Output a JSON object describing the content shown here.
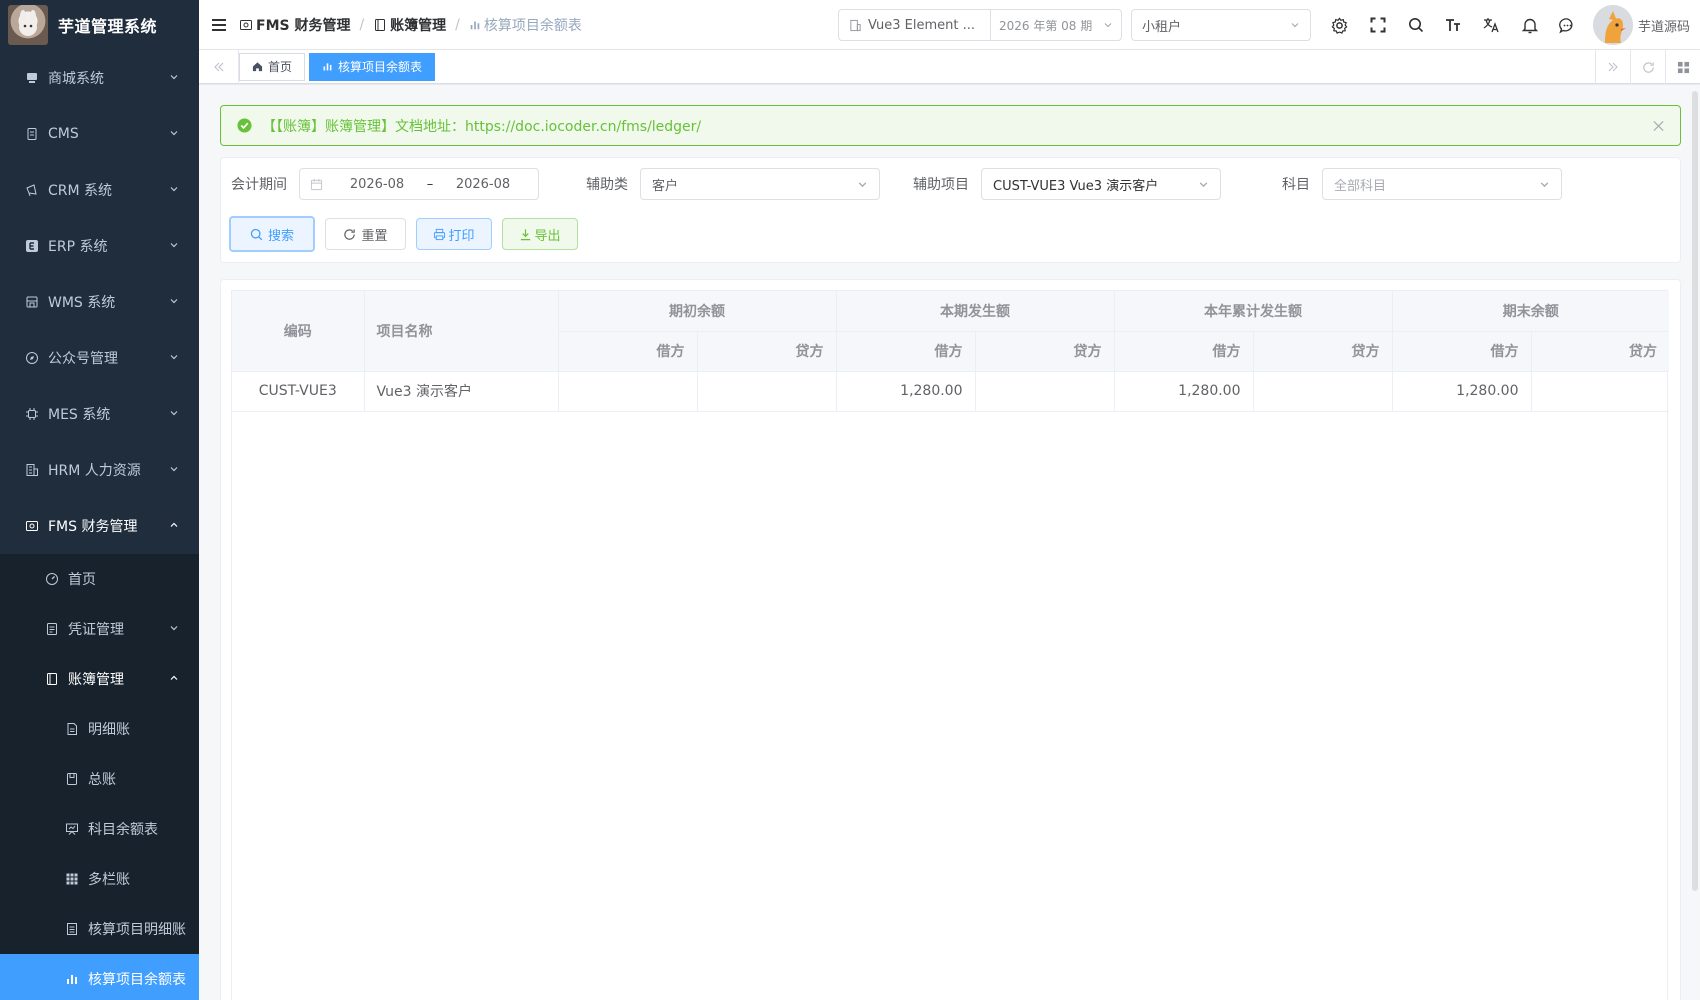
{
  "app": {
    "title": "芋道管理系统"
  },
  "sidebar": {
    "items": [
      {
        "label": "商城系统",
        "icon": "store-icon",
        "open": false
      },
      {
        "label": "CMS",
        "icon": "document-icon",
        "open": false
      },
      {
        "label": "CRM 系统",
        "icon": "megaphone-icon",
        "open": false
      },
      {
        "label": "ERP 系统",
        "icon": "erp-e-icon",
        "open": false
      },
      {
        "label": "WMS 系统",
        "icon": "warehouse-icon",
        "open": false
      },
      {
        "label": "公众号管理",
        "icon": "compass-icon",
        "open": false
      },
      {
        "label": "MES 系统",
        "icon": "chip-icon",
        "open": false
      },
      {
        "label": "HRM 人力资源",
        "icon": "building-icon",
        "open": false
      },
      {
        "label": "FMS 财务管理",
        "icon": "finance-icon",
        "open": true
      }
    ],
    "fms_children": [
      {
        "label": "首页",
        "icon": "dashboard-icon"
      },
      {
        "label": "凭证管理",
        "icon": "voucher-icon",
        "has_children": true
      },
      {
        "label": "账簿管理",
        "icon": "ledger-book-icon",
        "has_children": true,
        "open": true
      }
    ],
    "ledger_children": [
      {
        "label": "明细账",
        "icon": "detail-doc-icon"
      },
      {
        "label": "总账",
        "icon": "general-ledger-icon"
      },
      {
        "label": "科目余额表",
        "icon": "presentation-icon"
      },
      {
        "label": "多栏账",
        "icon": "grid-icon"
      },
      {
        "label": "核算项目明细账",
        "icon": "list-doc-icon"
      },
      {
        "label": "核算项目余额表",
        "icon": "bar-chart-icon",
        "active": true
      }
    ]
  },
  "navbar": {
    "breadcrumb": [
      "FMS 财务管理",
      "账簿管理",
      "核算项目余额表"
    ],
    "ledger_name": "Vue3 Element ...",
    "ledger_period": "2026 年第 08 期",
    "tenant": "小租户",
    "user_name": "芋道源码"
  },
  "tags": [
    {
      "label": "首页",
      "icon": "home-icon",
      "active": false
    },
    {
      "label": "核算项目余额表",
      "icon": "bar-chart-icon",
      "active": true
    }
  ],
  "alert": {
    "text": "【【账簿】账簿管理】文档地址：https://doc.iocoder.cn/fms/ledger/"
  },
  "filters": {
    "period_label": "会计期间",
    "period_start": "2026-08",
    "period_sep": "–",
    "period_end": "2026-08",
    "aux_type_label": "辅助类",
    "aux_type_value": "客户",
    "aux_item_label": "辅助项目",
    "aux_item_value": "CUST-VUE3 Vue3 演示客户",
    "subject_label": "科目",
    "subject_placeholder": "全部科目"
  },
  "buttons": {
    "search": "搜索",
    "reset": "重置",
    "print": "打印",
    "export": "导出"
  },
  "table": {
    "col_code": "编码",
    "col_name": "项目名称",
    "groups": [
      "期初余额",
      "本期发生额",
      "本年累计发生额",
      "期末余额"
    ],
    "debit": "借方",
    "credit": "贷方",
    "rows": [
      {
        "code": "CUST-VUE3",
        "name": "Vue3 演示客户",
        "opening_debit": "",
        "opening_credit": "",
        "period_debit": "1,280.00",
        "period_credit": "",
        "ytd_debit": "1,280.00",
        "ytd_credit": "",
        "closing_debit": "1,280.00",
        "closing_credit": ""
      }
    ]
  },
  "colors": {
    "primary": "#409eff",
    "success": "#67c23a",
    "sidebar_bg": "#1f2d3d"
  }
}
